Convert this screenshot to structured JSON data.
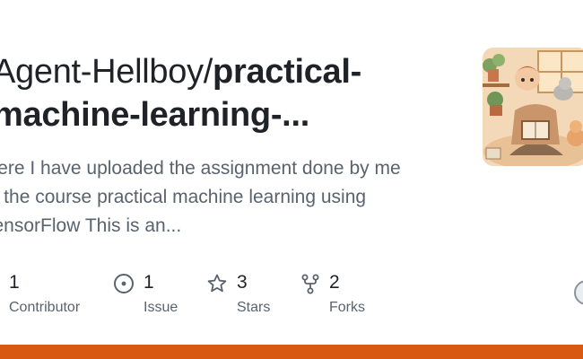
{
  "repo": {
    "owner_prefix": "Agent-Hellboy/",
    "name_line1": "practical-",
    "name_line2": "machine-learning-..."
  },
  "description": {
    "lines": [
      "Here I have uploaded the assignment done by me",
      "in the course practical machine learning using",
      "TensorFlow This is an..."
    ]
  },
  "stats": {
    "contributors": {
      "count": "1",
      "label": "Contributor",
      "icon": "people-icon"
    },
    "issues": {
      "count": "1",
      "label": "Issue",
      "icon": "issue-opened-icon"
    },
    "stars": {
      "count": "3",
      "label": "Stars",
      "icon": "star-icon"
    },
    "forks": {
      "count": "2",
      "label": "Forks",
      "icon": "repo-forked-icon"
    }
  },
  "colors": {
    "text": "#1f2328",
    "muted": "#59636e",
    "accent_bar": "#d85a12"
  }
}
